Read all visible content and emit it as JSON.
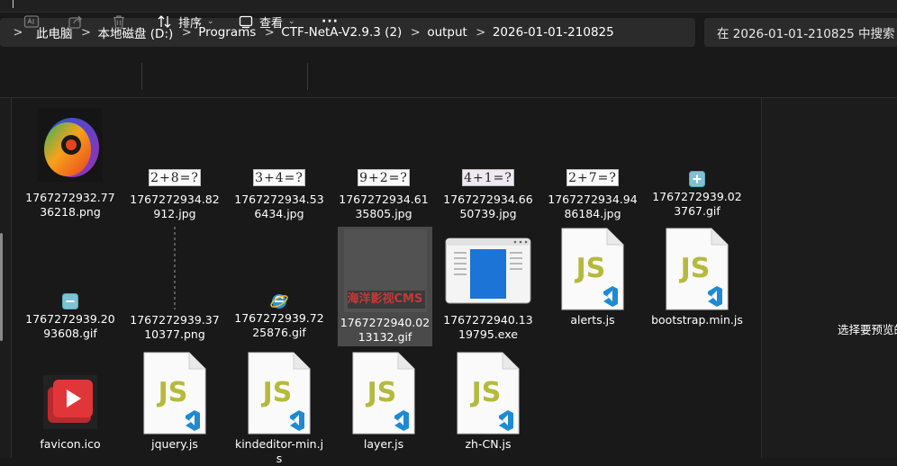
{
  "address_bar": {
    "segments": [
      "此电脑",
      "本地磁盘 (D:)",
      "Programs",
      "CTF-NetA-V2.9.3 (2)",
      "output",
      "2026-01-01-210825"
    ]
  },
  "search": {
    "placeholder": "在 2026-01-01-210825 中搜索"
  },
  "toolbar": {
    "sort_label": "排序",
    "view_label": "查看",
    "more_label": "···"
  },
  "files": [
    {
      "name": "1767272932.7736218.png",
      "kind": "logo-image"
    },
    {
      "name": "1767272934.82912.jpg",
      "kind": "captcha",
      "captcha_text": "2+8=?"
    },
    {
      "name": "1767272934.536434.jpg",
      "kind": "captcha",
      "captcha_text": "3+4=?"
    },
    {
      "name": "1767272934.6135805.jpg",
      "kind": "captcha",
      "captcha_text": "9+2=?"
    },
    {
      "name": "1767272934.6650739.jpg",
      "kind": "captcha",
      "captcha_text": "4+1=?"
    },
    {
      "name": "1767272934.9486184.jpg",
      "kind": "captcha",
      "captcha_text": "2+7=?"
    },
    {
      "name": "1767272939.023767.gif",
      "kind": "plus-icon"
    },
    {
      "name": "1767272939.2093608.gif",
      "kind": "minus-icon"
    },
    {
      "name": "1767272939.3710377.png",
      "kind": "thin-line"
    },
    {
      "name": "1767272939.7225876.gif",
      "kind": "ie-icon"
    },
    {
      "name": "1767272940.0213132.gif",
      "kind": "banner",
      "banner_text": "海洋影视CMS"
    },
    {
      "name": "1767272940.1319795.exe",
      "kind": "exe"
    },
    {
      "name": "alerts.js",
      "kind": "js"
    },
    {
      "name": "bootstrap.min.js",
      "kind": "js"
    },
    {
      "name": "favicon.ico",
      "kind": "favicon"
    },
    {
      "name": "jquery.js",
      "kind": "js"
    },
    {
      "name": "kindeditor-min.js",
      "kind": "js"
    },
    {
      "name": "layer.js",
      "kind": "js"
    },
    {
      "name": "zh-CN.js",
      "kind": "js"
    }
  ],
  "js_icon_text": "JS",
  "preview_pane": {
    "message": "选择要预览的"
  },
  "colors": {
    "accent_js": "#b5ba3c",
    "vscode_blue": "#1f8ad2",
    "favicon_red": "#e0363a",
    "selection": "#4a4a4a"
  }
}
